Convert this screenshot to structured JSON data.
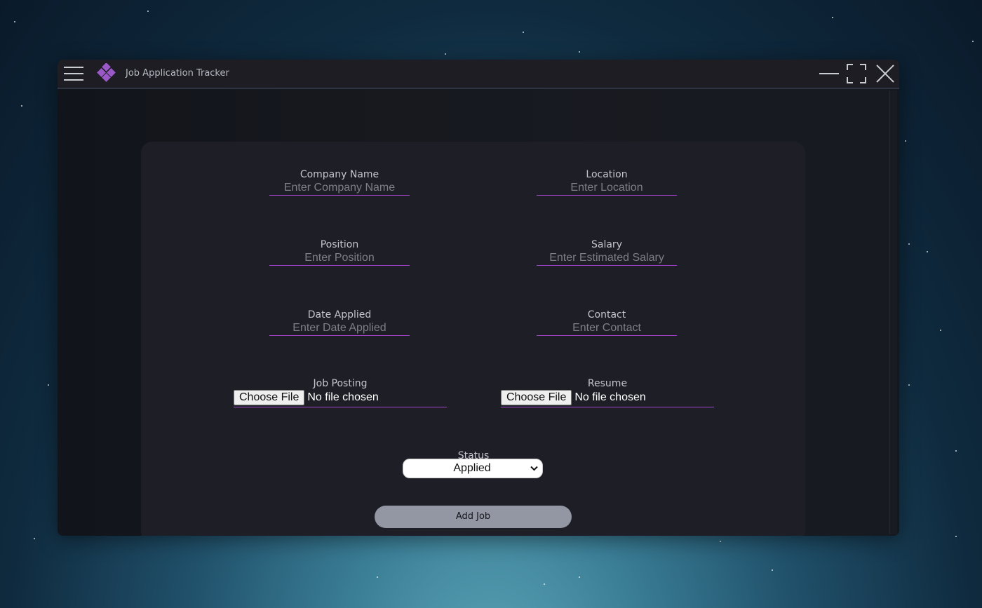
{
  "window": {
    "title": "Job Application Tracker",
    "accent_color": "#a444c8",
    "logo_color": "#9b59c8"
  },
  "form": {
    "fields": [
      {
        "label": "Company Name",
        "placeholder": "Enter Company Name"
      },
      {
        "label": "Location",
        "placeholder": "Enter Location"
      },
      {
        "label": "Position",
        "placeholder": "Enter Position"
      },
      {
        "label": "Salary",
        "placeholder": "Enter Estimated Salary"
      },
      {
        "label": "Date Applied",
        "placeholder": "Enter Date Applied"
      },
      {
        "label": "Contact",
        "placeholder": "Enter Contact"
      }
    ],
    "file_fields": [
      {
        "label": "Job Posting",
        "button_label": "Choose File",
        "status": "No file chosen"
      },
      {
        "label": "Resume",
        "button_label": "Choose File",
        "status": "No file chosen"
      }
    ],
    "status": {
      "label": "Status",
      "selected": "Applied"
    },
    "submit_label": "Add Job"
  },
  "icons": {
    "menu": "hamburger-menu-icon",
    "logo": "app-logo-icon",
    "minimize": "minimize-icon",
    "maximize": "maximize-icon",
    "close": "close-icon",
    "dropdown": "chevron-down-icon"
  }
}
